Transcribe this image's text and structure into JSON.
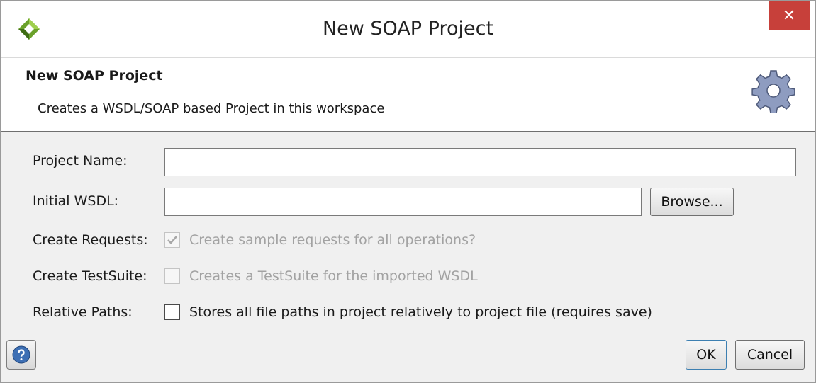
{
  "window": {
    "title": "New SOAP Project",
    "app_icon": "soapui-logo-icon",
    "close_icon": "close-icon",
    "close_glyph": "✕"
  },
  "banner": {
    "title": "New SOAP Project",
    "description": "Creates a WSDL/SOAP based Project in this workspace",
    "icon": "gear-icon"
  },
  "form": {
    "project_name": {
      "label": "Project Name:",
      "value": "",
      "placeholder": ""
    },
    "initial_wsdl": {
      "label": "Initial WSDL:",
      "value": "",
      "placeholder": "",
      "browse_label": "Browse..."
    },
    "create_requests": {
      "label": "Create Requests:",
      "text": "Create sample requests for all operations?",
      "checked": true,
      "enabled": false
    },
    "create_testsuite": {
      "label": "Create TestSuite:",
      "text": "Creates a TestSuite for the imported WSDL",
      "checked": false,
      "enabled": false
    },
    "relative_paths": {
      "label": "Relative Paths:",
      "text": "Stores all file paths in project relatively to project file (requires save)",
      "checked": false,
      "enabled": true
    }
  },
  "footer": {
    "help_icon": "help-icon",
    "ok_label": "OK",
    "cancel_label": "Cancel"
  },
  "colors": {
    "close_button": "#c7403a",
    "dialog_background": "#f0f0f0",
    "disabled_text": "#a2a2a2"
  }
}
